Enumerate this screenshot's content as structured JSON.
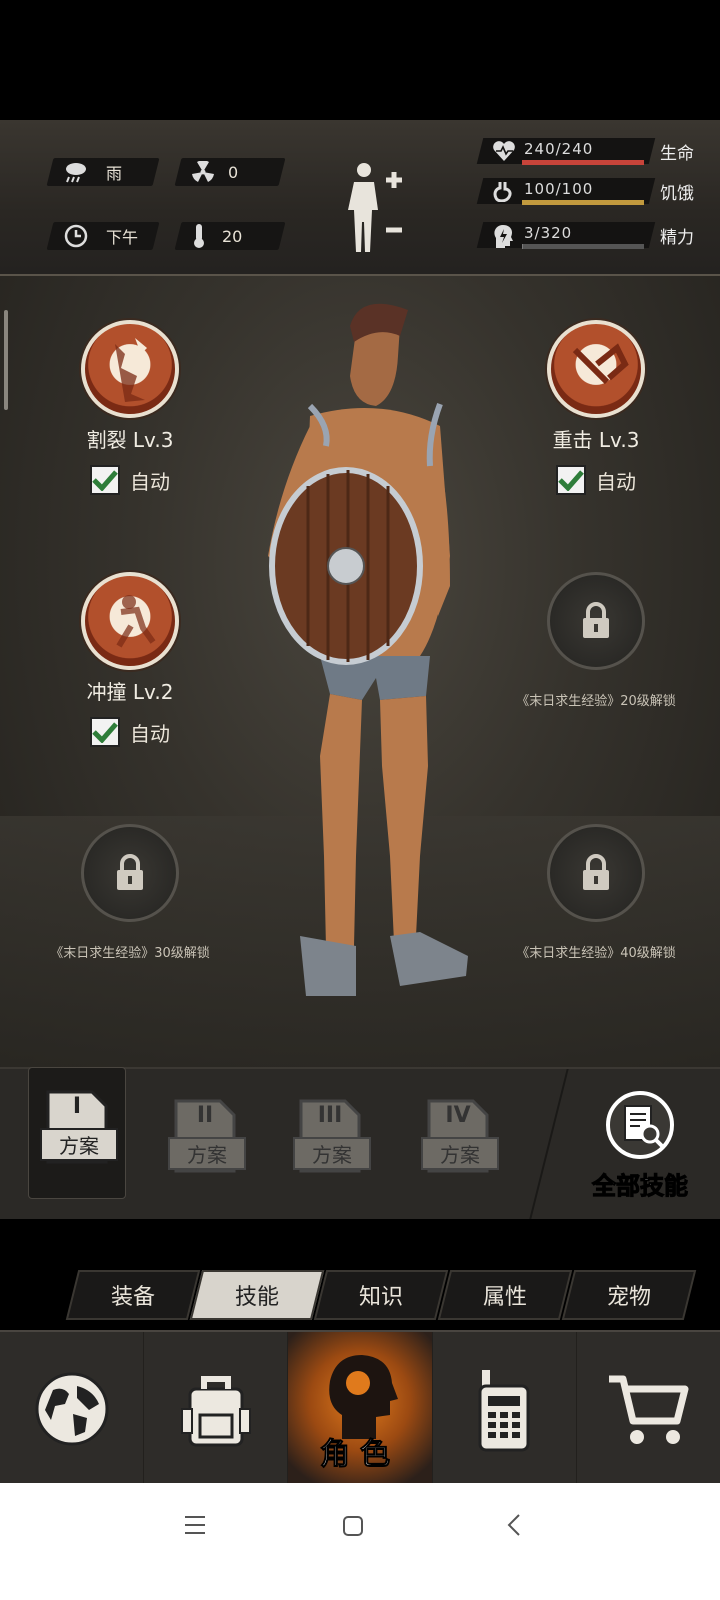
{
  "hud": {
    "weather": "雨",
    "radiation": "0",
    "time_of_day": "下午",
    "temperature": "20",
    "stats": [
      {
        "value": "240/240",
        "label": "生命",
        "fraction": 1.0,
        "color": "#c8443a",
        "icon": "heart-icon"
      },
      {
        "value": "100/100",
        "label": "饥饿",
        "fraction": 1.0,
        "color": "#c29a3e",
        "icon": "stomach-icon"
      },
      {
        "value": "3/320",
        "label": "精力",
        "fraction": 0.0094,
        "color": "#7a7a7a",
        "icon": "energy-head-icon"
      }
    ]
  },
  "skills": {
    "slot1": {
      "name": "割裂 Lv.3",
      "auto": "自动",
      "icon": "rend-skill-icon"
    },
    "slot2": {
      "name": "重击 Lv.3",
      "auto": "自动",
      "icon": "heavy-strike-skill-icon"
    },
    "slot3": {
      "name": "冲撞 Lv.2",
      "auto": "自动",
      "icon": "charge-skill-icon"
    },
    "locked1": {
      "caption": "《末日求生经验》20级解锁"
    },
    "locked2": {
      "caption": "《末日求生经验》30级解锁"
    },
    "locked3": {
      "caption": "《末日求生经验》40级解锁"
    }
  },
  "plans": [
    {
      "numeral": "I",
      "label": "方案",
      "selected": true
    },
    {
      "numeral": "II",
      "label": "方案",
      "selected": false
    },
    {
      "numeral": "III",
      "label": "方案",
      "selected": false
    },
    {
      "numeral": "IV",
      "label": "方案",
      "selected": false
    }
  ],
  "all_skills_label": "全部技能",
  "tabs": [
    "装备",
    "技能",
    "知识",
    "属性",
    "宠物"
  ],
  "active_tab": "技能",
  "bottom_nav": {
    "character_label": "角色"
  },
  "colors": {
    "accent": "#e07a1c",
    "health": "#c8443a",
    "hunger": "#c29a3e"
  }
}
